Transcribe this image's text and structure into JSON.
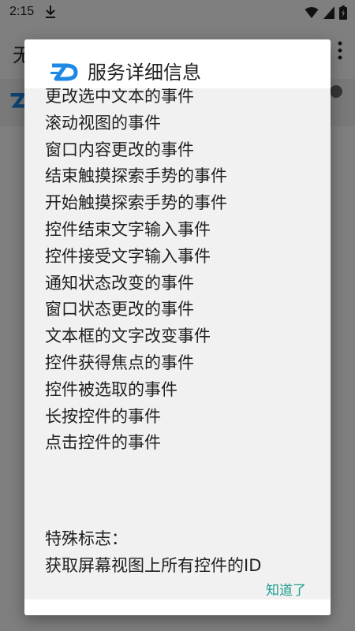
{
  "status_bar": {
    "time": "2:15"
  },
  "background_app": {
    "title_partial": "无"
  },
  "dialog": {
    "title": "服务详细信息",
    "events": [
      "更改选中文本的事件",
      "滚动视图的事件",
      "窗口内容更改的事件",
      "结束触摸探索手势的事件",
      "开始触摸探索手势的事件",
      "控件结束文字输入事件",
      "控件接受文字输入事件",
      "通知状态改变的事件",
      "窗口状态更改的事件",
      "文本框的文字改变事件",
      "控件获得焦点的事件",
      "控件被选取的事件",
      "长按控件的事件",
      "点击控件的事件"
    ],
    "special_label": "特殊标志：",
    "special_value": "获取屏幕视图上所有控件的ID",
    "ok_label": "知道了"
  },
  "colors": {
    "accent": "#1f9e8f",
    "logo": "#1e88e5",
    "dialog_body": "#f1f1f1"
  }
}
